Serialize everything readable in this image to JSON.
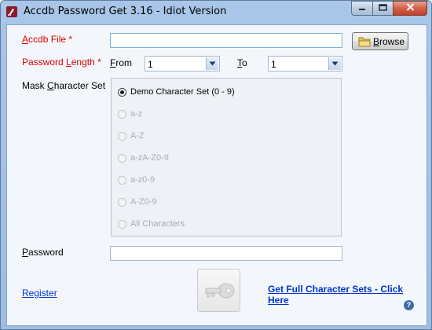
{
  "window": {
    "title": "Accdb Password Get 3.16 - Idiot Version",
    "controls": {
      "minimize": "minimize-icon",
      "maximize": "maximize-icon",
      "close": "close-icon"
    }
  },
  "form": {
    "file": {
      "label_prefix": "A",
      "label_rest": "ccdb File *",
      "value": "",
      "browse_prefix": "B",
      "browse_rest": "rowse"
    },
    "length": {
      "label_prefix": "Password ",
      "label_ul": "L",
      "label_rest": "ength *",
      "from_ul": "F",
      "from_rest": "rom",
      "from_value": "1",
      "to_ul": "T",
      "to_rest": "o",
      "to_value": "1"
    },
    "mask": {
      "label_prefix": "Mask ",
      "label_ul": "C",
      "label_rest": "haracter Set",
      "options": [
        {
          "label": "Demo Character Set (0 - 9)",
          "checked": true,
          "enabled": true
        },
        {
          "label": "a-z",
          "checked": false,
          "enabled": false
        },
        {
          "label": "A-Z",
          "checked": false,
          "enabled": false
        },
        {
          "label": "a-zA-Z0-9",
          "checked": false,
          "enabled": false
        },
        {
          "label": "a-z0-9",
          "checked": false,
          "enabled": false
        },
        {
          "label": "A-Z0-9",
          "checked": false,
          "enabled": false
        },
        {
          "label": "All Characters",
          "checked": false,
          "enabled": false
        }
      ]
    },
    "password": {
      "label_ul": "P",
      "label_rest": "assword",
      "value": ""
    }
  },
  "footer": {
    "register": "Register",
    "full_sets": "Get Full Character Sets - Click Here",
    "help": "?",
    "key_icon": "key-icon"
  },
  "colors": {
    "required_label": "#e00000",
    "link": "#0033cc"
  }
}
